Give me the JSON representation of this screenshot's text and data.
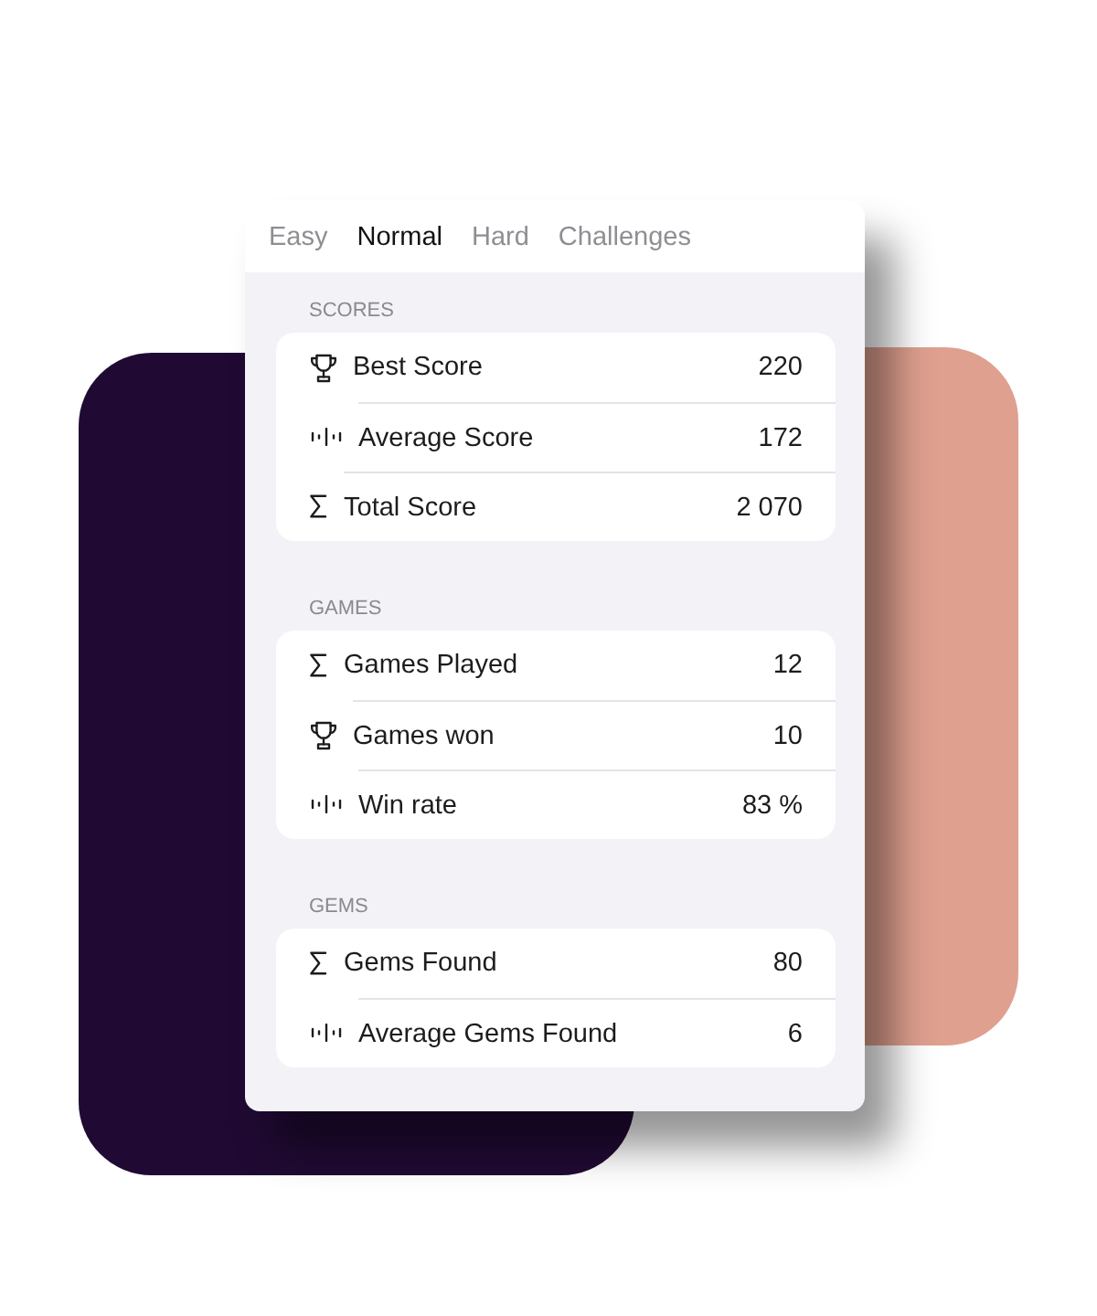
{
  "tabs": [
    {
      "label": "Easy",
      "selected": false
    },
    {
      "label": "Normal",
      "selected": true
    },
    {
      "label": "Hard",
      "selected": false
    },
    {
      "label": "Challenges",
      "selected": false
    }
  ],
  "sections": [
    {
      "title": "SCORES",
      "rows": [
        {
          "kind": "trophy",
          "label": "Best Score",
          "value": "220"
        },
        {
          "kind": "average",
          "label": "Average Score",
          "value": "172"
        },
        {
          "kind": "sum",
          "label": "Total Score",
          "value": "2 070"
        }
      ]
    },
    {
      "title": "GAMES",
      "rows": [
        {
          "kind": "sum",
          "label": "Games Played",
          "value": "12"
        },
        {
          "kind": "trophy",
          "label": "Games won",
          "value": "10"
        },
        {
          "kind": "average",
          "label": "Win rate",
          "value": "83 %"
        }
      ]
    },
    {
      "title": "GEMS",
      "rows": [
        {
          "kind": "sum",
          "label": "Gems Found",
          "value": "80"
        },
        {
          "kind": "average",
          "label": "Average Gems Found",
          "value": "6"
        }
      ]
    }
  ]
}
